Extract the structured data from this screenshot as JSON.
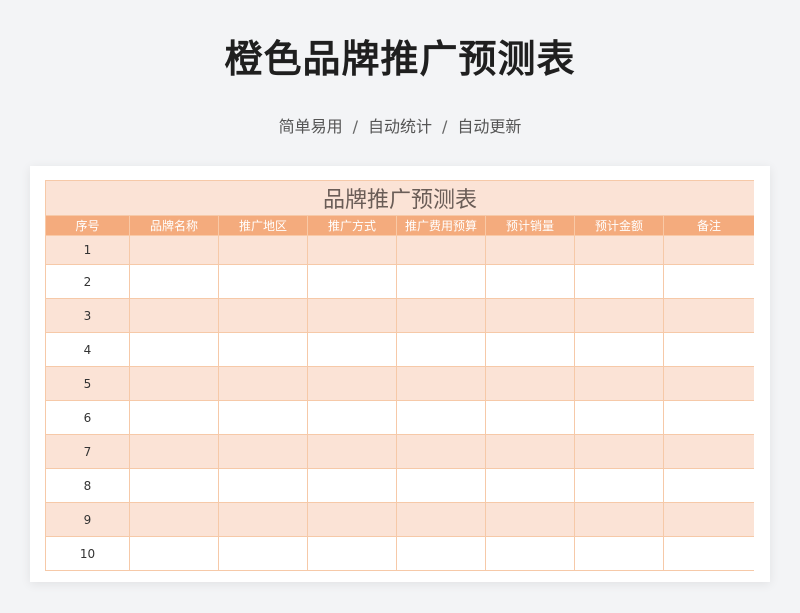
{
  "title": "橙色品牌推广预测表",
  "subtitle": {
    "part1": "简单易用",
    "part2": "自动统计",
    "part3": "自动更新",
    "separator": "/"
  },
  "sheet": {
    "title": "品牌推广预测表",
    "columns": [
      "序号",
      "品牌名称",
      "推广地区",
      "推广方式",
      "推广费用预算",
      "预计销量",
      "预计金额",
      "备注"
    ],
    "rows": [
      [
        "1",
        "",
        "",
        "",
        "",
        "",
        "",
        ""
      ],
      [
        "2",
        "",
        "",
        "",
        "",
        "",
        "",
        ""
      ],
      [
        "3",
        "",
        "",
        "",
        "",
        "",
        "",
        ""
      ],
      [
        "4",
        "",
        "",
        "",
        "",
        "",
        "",
        ""
      ],
      [
        "5",
        "",
        "",
        "",
        "",
        "",
        "",
        ""
      ],
      [
        "6",
        "",
        "",
        "",
        "",
        "",
        "",
        ""
      ],
      [
        "7",
        "",
        "",
        "",
        "",
        "",
        "",
        ""
      ],
      [
        "8",
        "",
        "",
        "",
        "",
        "",
        "",
        ""
      ],
      [
        "9",
        "",
        "",
        "",
        "",
        "",
        "",
        ""
      ],
      [
        "10",
        "",
        "",
        "",
        "",
        "",
        "",
        ""
      ]
    ]
  },
  "colors": {
    "accent_header": "#f4ab7d",
    "band_light": "#fbe3d6",
    "grid_line": "#f6c9a8"
  }
}
